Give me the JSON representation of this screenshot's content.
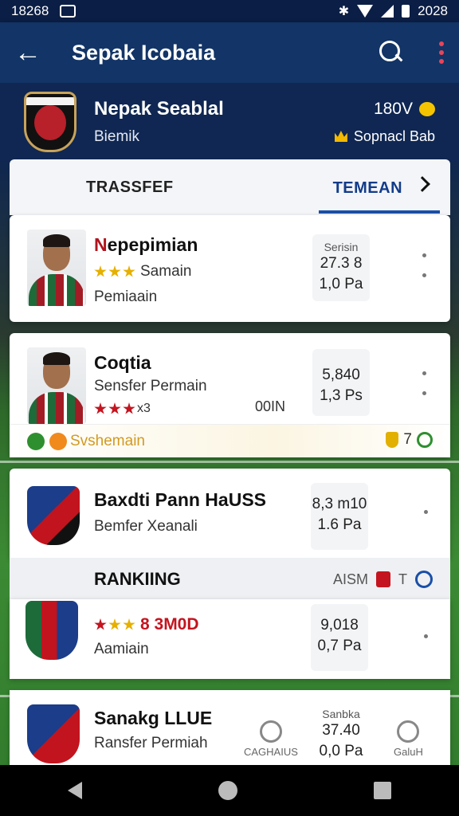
{
  "status": {
    "time": "18268",
    "right_text": "2028"
  },
  "appbar": {
    "title": "Sepak Icobaia"
  },
  "club": {
    "name": "Nepak Seablal",
    "subtitle": "Biemik",
    "score": "180V",
    "rank_label": "Sopnacl Bab"
  },
  "tabs": [
    {
      "label": "TRASSFEF",
      "active": false
    },
    {
      "label": "TEMEAN",
      "active": true
    }
  ],
  "players": [
    {
      "name_first": "N",
      "name_rest": "epepimian",
      "line1": "Samain",
      "line2": "Pemiaain",
      "stars_gold": 3,
      "stat_label": "Serisin",
      "stat_v1": "27.3 8",
      "stat_v2": "1,0 Pa"
    },
    {
      "name_first": "",
      "name_rest": "Coqtia",
      "line1": "Sensfer Permain",
      "line2": "x3",
      "stars_red": 3,
      "middle": "00IN",
      "stat_v1": "5,840",
      "stat_v2": "1,3 Ps"
    }
  ],
  "promo": {
    "text": "Svshemain",
    "right": "7"
  },
  "clubs": [
    {
      "name": "Baxdti Pann HaUSS",
      "line": "Bemfer Xeanali",
      "stat_v1": "8,3 m10",
      "stat_v2": "1.6 Pa"
    }
  ],
  "ranking": {
    "title": "RANKIING",
    "label": "AISM",
    "num": "T"
  },
  "ranked_clubs": [
    {
      "stars_text": "8 3M0D",
      "line": "Aamiain",
      "stat_v1": "9,018",
      "stat_v2": "0,7 Pa"
    },
    {
      "name": "Sanakg LLUE",
      "line": "Ransfer Permiah",
      "stat_label": "Sanbka",
      "stat_v1": "37.40",
      "stat_v2": "0,0 Pa"
    }
  ],
  "bottom_icons": [
    "CAGHAIUS",
    "GaluH"
  ]
}
